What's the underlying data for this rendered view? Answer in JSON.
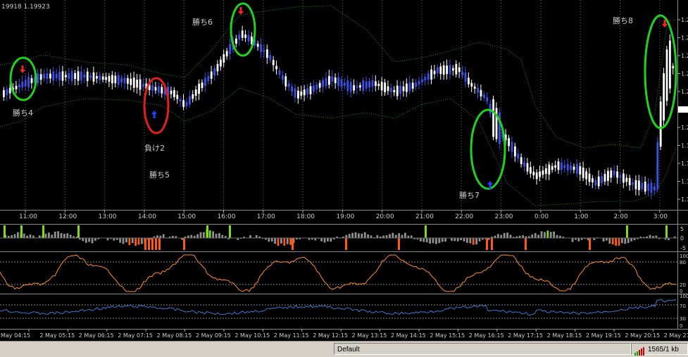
{
  "price_header": "19918 1.19923",
  "colors": {
    "bull": "#ffffff",
    "bear": "#3c50e6",
    "band": "#1e8c1e",
    "win": "#1ed21e",
    "loss": "#e61e1e",
    "hist_up": "#7ddc1e",
    "hist_dn": "#ff5a14",
    "stoch": "#ff8c1e",
    "line3": "#3c78d2"
  },
  "annotations": [
    {
      "id": "win4",
      "label": "勝ち4"
    },
    {
      "id": "loss2",
      "label": "負け2"
    },
    {
      "id": "win5",
      "label": "勝ち5"
    },
    {
      "id": "win6",
      "label": "勝ち6"
    },
    {
      "id": "win7",
      "label": "勝ち7"
    },
    {
      "id": "win8",
      "label": "勝ち8"
    }
  ],
  "time_labels": [
    "11:00",
    "12:00",
    "13:00",
    "14:00",
    "15:00",
    "16:00",
    "17:00",
    "18:00",
    "19:00",
    "20:00",
    "21:00",
    "22:00",
    "23:00",
    "0:00",
    "1:00",
    "2:00",
    "3:00"
  ],
  "date_labels": [
    "May 04:15",
    "2 May 05:15",
    "2 May 06:15",
    "2 May 07:15",
    "2 May 08:15",
    "2 May 09:15",
    "2 May 10:15",
    "2 May 11:15",
    "2 May 12:15",
    "2 May 13:15",
    "2 May 14:15",
    "2 May 15:15",
    "2 May 16:15",
    "2 May 17:15",
    "2 May 18:15",
    "2 May 19:15",
    "2 May 20:15",
    "2 May 21"
  ],
  "price_ticks": [
    "1.2",
    "1.2",
    "1.2",
    "1.2",
    "1.2",
    "1.2",
    "1.2",
    "1.1",
    "1.1",
    "1.1",
    "1.1"
  ],
  "hist_ticks": [
    "5",
    "0",
    "-5"
  ],
  "stoch_ticks": [
    "100",
    "80",
    "20",
    "0"
  ],
  "line3_ticks": [
    "100",
    "70",
    "30",
    "0"
  ],
  "status": {
    "profile": "Default",
    "traffic": "1565/1 kb"
  }
}
